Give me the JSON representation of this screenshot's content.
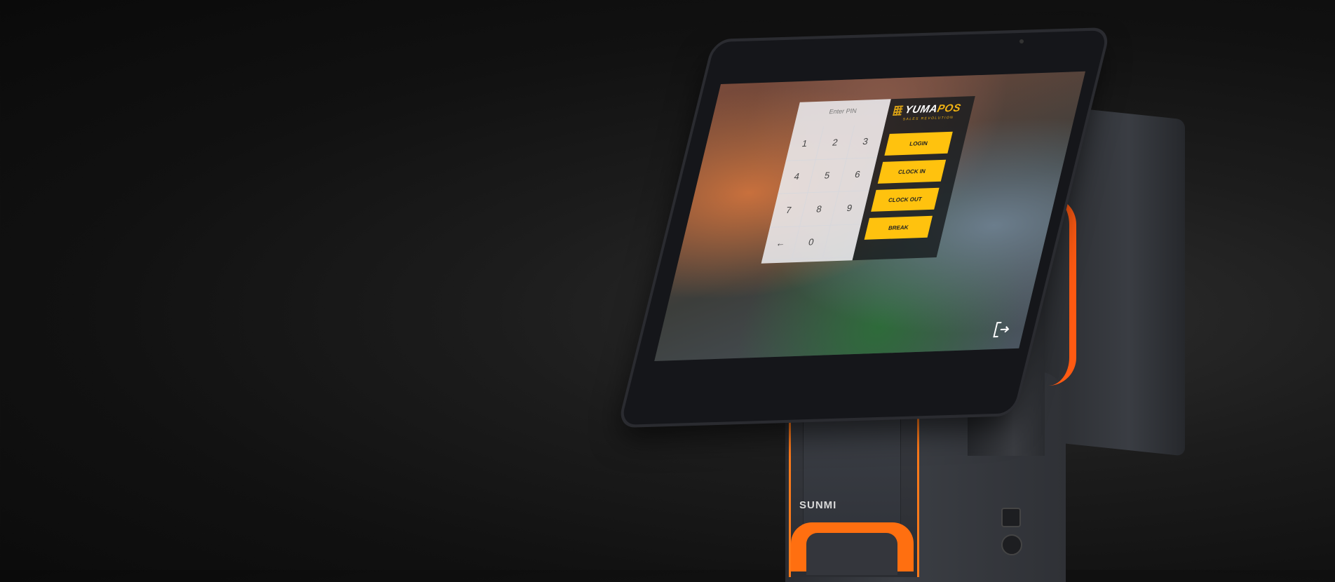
{
  "device": {
    "brand_logo": "SUNMI"
  },
  "pos_app": {
    "logo_main": "YUMA",
    "logo_accent": "POS",
    "logo_tagline": "SALES REVOLUTION",
    "pin_placeholder": "Enter PIN",
    "keypad": [
      "1",
      "2",
      "3",
      "4",
      "5",
      "6",
      "7",
      "8",
      "9",
      "←",
      "0",
      ""
    ],
    "buttons": {
      "login": "LOGIN",
      "clock_in": "CLOCK IN",
      "clock_out": "CLOCK OUT",
      "break": "BREAK"
    },
    "accent_color": "#ffc20e",
    "logout_icon": "logout-icon"
  }
}
